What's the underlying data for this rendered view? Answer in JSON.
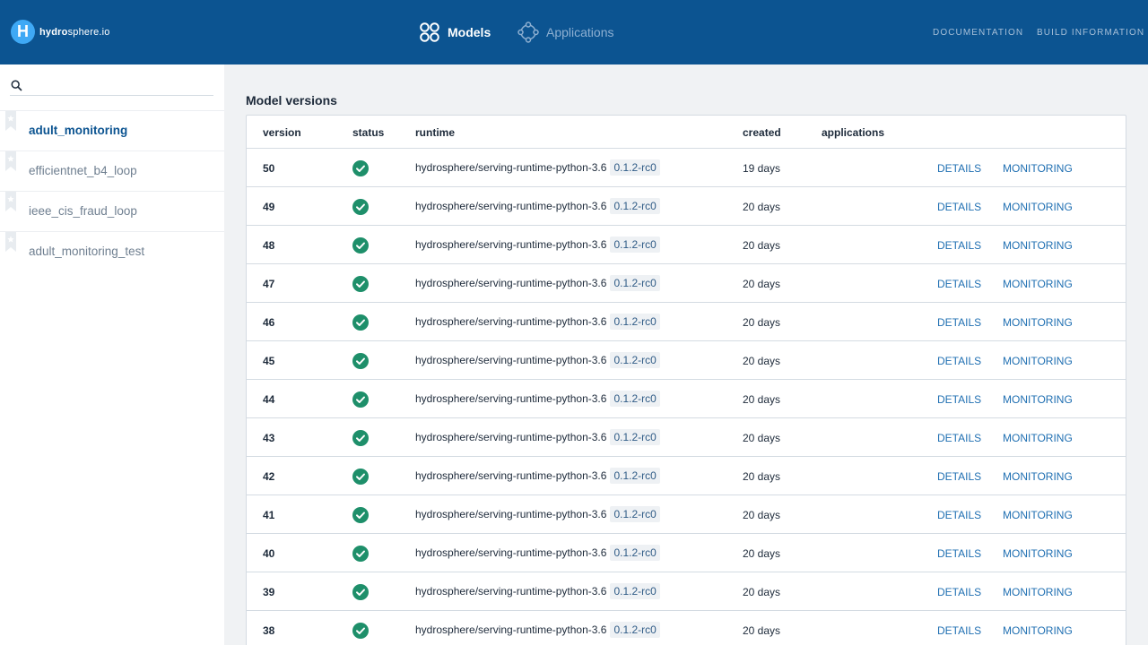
{
  "header": {
    "logo_letter": "H",
    "logo_bold": "hydro",
    "logo_rest": "sphere.io",
    "nav": [
      {
        "label": "Models",
        "icon": "models-icon",
        "active": true
      },
      {
        "label": "Applications",
        "icon": "applications-icon",
        "active": false
      }
    ],
    "documentation": "DOCUMENTATION",
    "build_information": "BUILD INFORMATION"
  },
  "sidebar": {
    "search_placeholder": "",
    "items": [
      {
        "label": "adult_monitoring",
        "active": true
      },
      {
        "label": "efficientnet_b4_loop",
        "active": false
      },
      {
        "label": "ieee_cis_fraud_loop",
        "active": false
      },
      {
        "label": "adult_monitoring_test",
        "active": false
      }
    ]
  },
  "main": {
    "title": "Model versions",
    "columns": {
      "version": "version",
      "status": "status",
      "runtime": "runtime",
      "created": "created",
      "applications": "applications"
    },
    "rows": [
      {
        "version": "50",
        "status": "released",
        "runtime": "hydrosphere/serving-runtime-python-3.6",
        "tag": "0.1.2-rc0",
        "created": "19 days",
        "applications": "",
        "details": "DETAILS",
        "monitoring": "MONITORING"
      },
      {
        "version": "49",
        "status": "released",
        "runtime": "hydrosphere/serving-runtime-python-3.6",
        "tag": "0.1.2-rc0",
        "created": "20 days",
        "applications": "",
        "details": "DETAILS",
        "monitoring": "MONITORING"
      },
      {
        "version": "48",
        "status": "released",
        "runtime": "hydrosphere/serving-runtime-python-3.6",
        "tag": "0.1.2-rc0",
        "created": "20 days",
        "applications": "",
        "details": "DETAILS",
        "monitoring": "MONITORING"
      },
      {
        "version": "47",
        "status": "released",
        "runtime": "hydrosphere/serving-runtime-python-3.6",
        "tag": "0.1.2-rc0",
        "created": "20 days",
        "applications": "",
        "details": "DETAILS",
        "monitoring": "MONITORING"
      },
      {
        "version": "46",
        "status": "released",
        "runtime": "hydrosphere/serving-runtime-python-3.6",
        "tag": "0.1.2-rc0",
        "created": "20 days",
        "applications": "",
        "details": "DETAILS",
        "monitoring": "MONITORING"
      },
      {
        "version": "45",
        "status": "released",
        "runtime": "hydrosphere/serving-runtime-python-3.6",
        "tag": "0.1.2-rc0",
        "created": "20 days",
        "applications": "",
        "details": "DETAILS",
        "monitoring": "MONITORING"
      },
      {
        "version": "44",
        "status": "released",
        "runtime": "hydrosphere/serving-runtime-python-3.6",
        "tag": "0.1.2-rc0",
        "created": "20 days",
        "applications": "",
        "details": "DETAILS",
        "monitoring": "MONITORING"
      },
      {
        "version": "43",
        "status": "released",
        "runtime": "hydrosphere/serving-runtime-python-3.6",
        "tag": "0.1.2-rc0",
        "created": "20 days",
        "applications": "",
        "details": "DETAILS",
        "monitoring": "MONITORING"
      },
      {
        "version": "42",
        "status": "released",
        "runtime": "hydrosphere/serving-runtime-python-3.6",
        "tag": "0.1.2-rc0",
        "created": "20 days",
        "applications": "",
        "details": "DETAILS",
        "monitoring": "MONITORING"
      },
      {
        "version": "41",
        "status": "released",
        "runtime": "hydrosphere/serving-runtime-python-3.6",
        "tag": "0.1.2-rc0",
        "created": "20 days",
        "applications": "",
        "details": "DETAILS",
        "monitoring": "MONITORING"
      },
      {
        "version": "40",
        "status": "released",
        "runtime": "hydrosphere/serving-runtime-python-3.6",
        "tag": "0.1.2-rc0",
        "created": "20 days",
        "applications": "",
        "details": "DETAILS",
        "monitoring": "MONITORING"
      },
      {
        "version": "39",
        "status": "released",
        "runtime": "hydrosphere/serving-runtime-python-3.6",
        "tag": "0.1.2-rc0",
        "created": "20 days",
        "applications": "",
        "details": "DETAILS",
        "monitoring": "MONITORING"
      },
      {
        "version": "38",
        "status": "released",
        "runtime": "hydrosphere/serving-runtime-python-3.6",
        "tag": "0.1.2-rc0",
        "created": "20 days",
        "applications": "",
        "details": "DETAILS",
        "monitoring": "MONITORING"
      }
    ]
  },
  "colors": {
    "header_bg": "#0c5491",
    "status_ok": "#1e8f6a",
    "link": "#1f6fb2",
    "logo_badge": "#3fa9f5"
  }
}
